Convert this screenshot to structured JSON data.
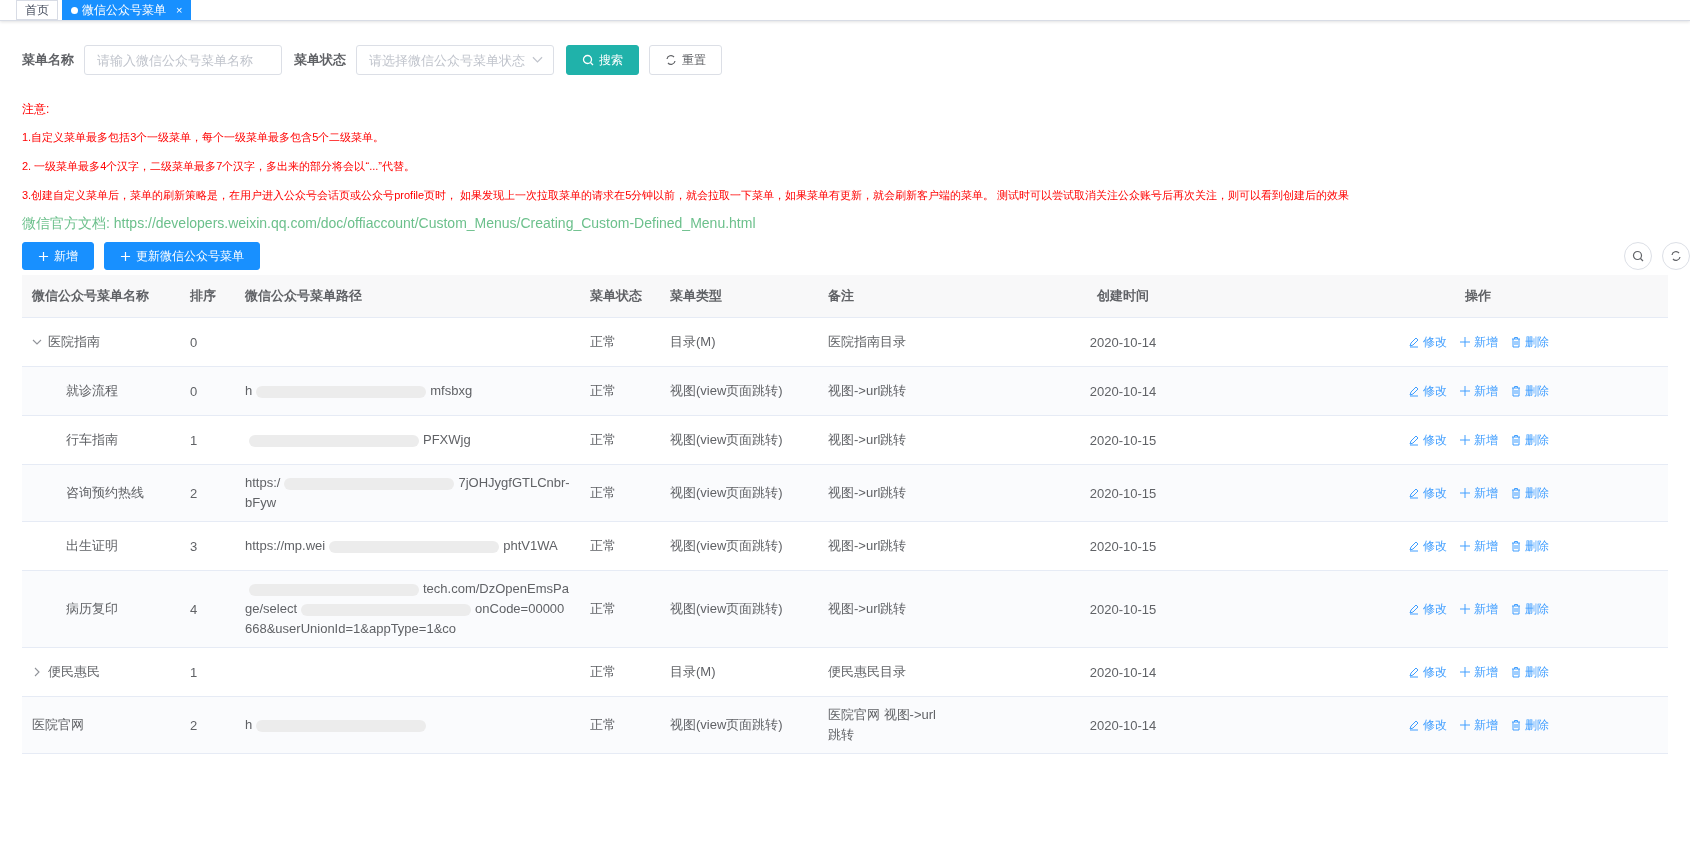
{
  "tabs": [
    {
      "label": "首页",
      "selected": false
    },
    {
      "label": "微信公众号菜单",
      "selected": true,
      "close": "×"
    }
  ],
  "filters": [
    {
      "label": "菜单名称",
      "kind": "input",
      "placeholder": "请输入微信公众号菜单名称"
    },
    {
      "label": "菜单状态",
      "kind": "select",
      "placeholder": "请选择微信公众号菜单状态"
    }
  ],
  "search_button": "搜索",
  "reset_button": "重置",
  "notice": {
    "title": "注意:",
    "lines": [
      "1.自定义菜单最多包括3个一级菜单，每个一级菜单最多包含5个二级菜单。",
      "2. 一级菜单最多4个汉字，二级菜单最多7个汉字，多出来的部分将会以“...”代替。",
      "3.创建自定义菜单后，菜单的刷新策略是，在用户进入公众号会话页或公众号profile页时， 如果发现上一次拉取菜单的请求在5分钟以前，就会拉取一下菜单，如果菜单有更新，就会刷新客户端的菜单。 测试时可以尝试取消关注公众账号后再次关注，则可以看到创建后的效果"
    ]
  },
  "doc_link": {
    "label": "微信官方文档:",
    "url": "https://developers.weixin.qq.com/doc/offiaccount/Custom_Menus/Creating_Custom-Defined_Menu.html"
  },
  "toolbar": {
    "add": "新增",
    "update": "更新微信公众号菜单"
  },
  "table": {
    "columns": [
      "微信公众号菜单名称",
      "排序",
      "微信公众号菜单路径",
      "菜单状态",
      "菜单类型",
      "备注",
      "创建时间",
      "操作"
    ],
    "rows": [
      {
        "name": "医院指南",
        "order": "0",
        "status": "正常",
        "type": "目录(M)",
        "remark": "医院指南目录",
        "created": "2020-10-14",
        "actions": [
          "修改",
          "新增",
          "删除"
        ],
        "expanded": true,
        "children": [
          {
            "name": "就诊流程",
            "order": "0",
            "path": [
              "h",
              "mfsbxg"
            ],
            "status": "正常",
            "type": "视图(view页面跳转)",
            "remark": "视图->url跳转",
            "created": "2020-10-14",
            "actions": [
              "修改",
              "新增",
              "删除"
            ]
          },
          {
            "name": "行车指南",
            "order": "1",
            "path_redacted_start": true,
            "path": [
              "PFXWjg"
            ],
            "status": "正常",
            "type": "视图(view页面跳转)",
            "remark": "视图->url跳转",
            "created": "2020-10-15",
            "actions": [
              "修改",
              "新增",
              "删除"
            ]
          },
          {
            "name": "咨询预约热线",
            "order": "2",
            "path": [
              "https:/",
              "7jOHJygfGTLCnbr-bFyw"
            ],
            "status": "正常",
            "type": "视图(view页面跳转)",
            "remark": "视图->url跳转",
            "created": "2020-10-15",
            "actions": [
              "修改",
              "新增",
              "删除"
            ]
          },
          {
            "name": "出生证明",
            "order": "3",
            "path": [
              "https://mp.wei",
              "phtV1WA"
            ],
            "status": "正常",
            "type": "视图(view页面跳转)",
            "remark": "视图->url跳转",
            "created": "2020-10-15",
            "actions": [
              "修改",
              "新增",
              "删除"
            ]
          },
          {
            "name": "病历复印",
            "order": "4",
            "path_redacted_start": true,
            "path": [
              "tech.com/DzOpenEmsPage/select",
              "onCode=00000668&userUnionId=1&appType=1&co"
            ],
            "status": "正常",
            "type": "视图(view页面跳转)",
            "remark": "视图->url跳转",
            "created": "2020-10-15",
            "actions": [
              "修改",
              "新增",
              "删除"
            ]
          }
        ]
      },
      {
        "name": "便民惠民",
        "order": "1",
        "status": "正常",
        "type": "目录(M)",
        "remark": "便民惠民目录",
        "created": "2020-10-14",
        "actions": [
          "修改",
          "新增",
          "删除"
        ],
        "expanded": false
      },
      {
        "name": "医院官网",
        "order": "2",
        "path": [
          "h"
        ],
        "status": "正常",
        "type": "视图(view页面跳转)",
        "remark": "医院官网 视图->url跳转",
        "created": "2020-10-14",
        "actions": [
          "修改",
          "新增",
          "删除"
        ]
      }
    ]
  }
}
